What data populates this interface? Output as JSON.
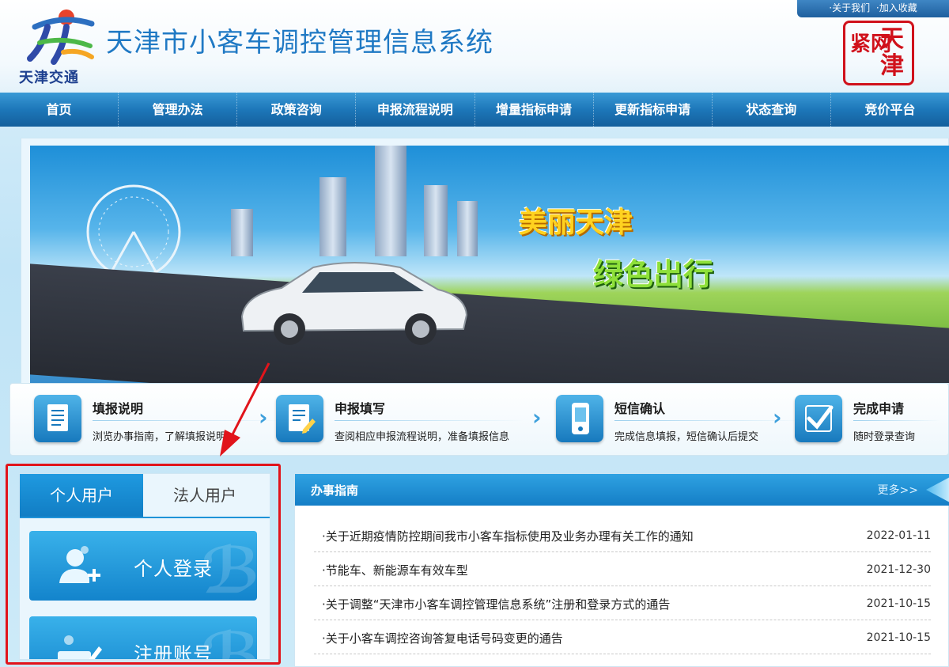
{
  "header": {
    "top_links": {
      "about": "·关于我们",
      "bookmark": "·加入收藏"
    },
    "logo_text": "天津交通",
    "site_title": "天津市小客车调控管理信息系统",
    "seal": {
      "left": "紧网",
      "right": "天津"
    }
  },
  "nav": {
    "items": [
      "首页",
      "管理办法",
      "政策咨询",
      "申报流程说明",
      "增量指标申请",
      "更新指标申请",
      "状态查询",
      "竞价平台"
    ]
  },
  "banner": {
    "slogan1": "美丽天津",
    "slogan2": "绿色出行"
  },
  "steps": [
    {
      "title": "填报说明",
      "desc": "浏览办事指南，了解填报说明"
    },
    {
      "title": "申报填写",
      "desc": "查阅相应申报流程说明，准备填报信息"
    },
    {
      "title": "短信确认",
      "desc": "完成信息填报，短信确认后提交"
    },
    {
      "title": "完成申请",
      "desc": "随时登录查询"
    }
  ],
  "login": {
    "tabs": {
      "personal": "个人用户",
      "corporate": "法人用户"
    },
    "personal_login": "个人登录",
    "register": "注册账号"
  },
  "news": {
    "title": "办事指南",
    "more": "更多>>",
    "items": [
      {
        "title": "·关于近期疫情防控期间我市小客车指标使用及业务办理有关工作的通知",
        "date": "2022-01-11"
      },
      {
        "title": "·节能车、新能源车有效车型",
        "date": "2021-12-30"
      },
      {
        "title": "·关于调整“天津市小客车调控管理信息系统”注册和登录方式的通告",
        "date": "2021-10-15"
      },
      {
        "title": "·关于小客车调控咨询答复电话号码变更的通告",
        "date": "2021-10-15"
      }
    ]
  },
  "colors": {
    "brand": "#1f79c4",
    "nav": "#1d77b9",
    "highlight": "#e1141b"
  }
}
